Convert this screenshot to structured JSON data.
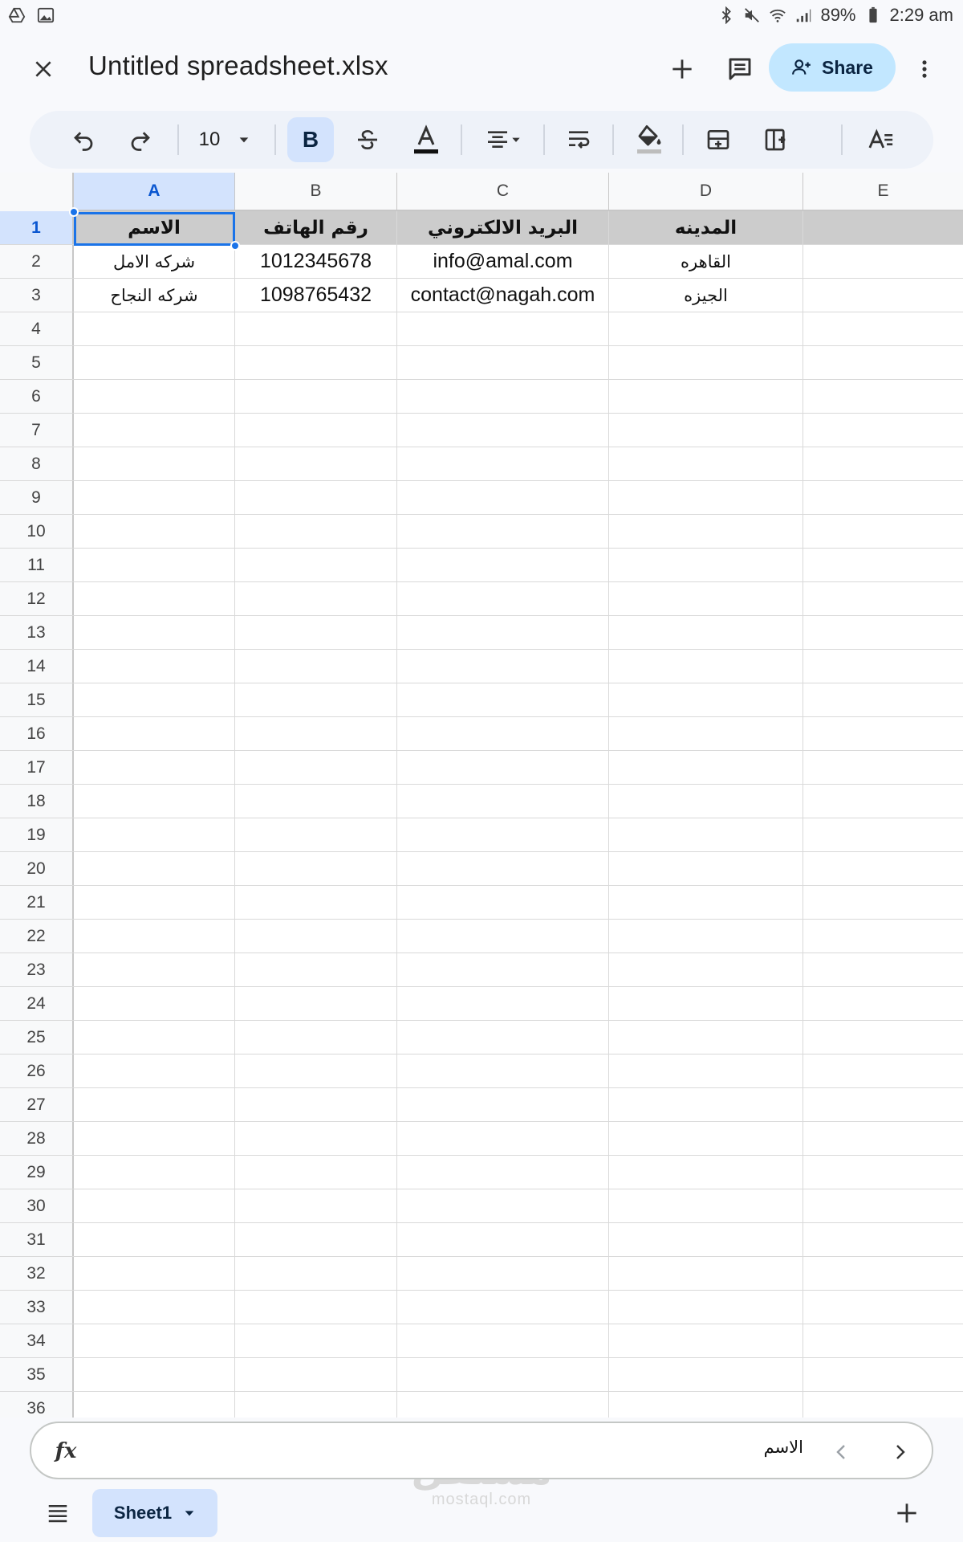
{
  "status_bar": {
    "battery": "89%",
    "time": "2:29 am"
  },
  "title_bar": {
    "doc_title": "Untitled spreadsheet.xlsx",
    "share_label": "Share"
  },
  "toolbar": {
    "font_size": "10",
    "bold_label": "B"
  },
  "grid": {
    "columns": [
      "A",
      "B",
      "C",
      "D",
      "E"
    ],
    "selected_column": "A",
    "selected_row": "1",
    "rows": [
      {
        "num": "1",
        "cells": [
          "الاسم",
          "رقم الهاتف",
          "البريد الالكتروني",
          "المدينه",
          ""
        ]
      },
      {
        "num": "2",
        "cells": [
          "شركه الامل",
          "1012345678",
          "info@amal.com",
          "القاهره",
          ""
        ]
      },
      {
        "num": "3",
        "cells": [
          "شركه النجاح",
          "1098765432",
          "contact@nagah.com",
          "الجيزه",
          ""
        ]
      },
      {
        "num": "4",
        "cells": [
          "",
          "",
          "",
          "",
          ""
        ]
      },
      {
        "num": "5",
        "cells": [
          "",
          "",
          "",
          "",
          ""
        ]
      },
      {
        "num": "6",
        "cells": [
          "",
          "",
          "",
          "",
          ""
        ]
      },
      {
        "num": "7",
        "cells": [
          "",
          "",
          "",
          "",
          ""
        ]
      },
      {
        "num": "8",
        "cells": [
          "",
          "",
          "",
          "",
          ""
        ]
      },
      {
        "num": "9",
        "cells": [
          "",
          "",
          "",
          "",
          ""
        ]
      },
      {
        "num": "10",
        "cells": [
          "",
          "",
          "",
          "",
          ""
        ]
      },
      {
        "num": "11",
        "cells": [
          "",
          "",
          "",
          "",
          ""
        ]
      },
      {
        "num": "12",
        "cells": [
          "",
          "",
          "",
          "",
          ""
        ]
      },
      {
        "num": "13",
        "cells": [
          "",
          "",
          "",
          "",
          ""
        ]
      },
      {
        "num": "14",
        "cells": [
          "",
          "",
          "",
          "",
          ""
        ]
      },
      {
        "num": "15",
        "cells": [
          "",
          "",
          "",
          "",
          ""
        ]
      },
      {
        "num": "16",
        "cells": [
          "",
          "",
          "",
          "",
          ""
        ]
      },
      {
        "num": "17",
        "cells": [
          "",
          "",
          "",
          "",
          ""
        ]
      },
      {
        "num": "18",
        "cells": [
          "",
          "",
          "",
          "",
          ""
        ]
      },
      {
        "num": "19",
        "cells": [
          "",
          "",
          "",
          "",
          ""
        ]
      },
      {
        "num": "20",
        "cells": [
          "",
          "",
          "",
          "",
          ""
        ]
      },
      {
        "num": "21",
        "cells": [
          "",
          "",
          "",
          "",
          ""
        ]
      },
      {
        "num": "22",
        "cells": [
          "",
          "",
          "",
          "",
          ""
        ]
      },
      {
        "num": "23",
        "cells": [
          "",
          "",
          "",
          "",
          ""
        ]
      },
      {
        "num": "24",
        "cells": [
          "",
          "",
          "",
          "",
          ""
        ]
      },
      {
        "num": "25",
        "cells": [
          "",
          "",
          "",
          "",
          ""
        ]
      },
      {
        "num": "26",
        "cells": [
          "",
          "",
          "",
          "",
          ""
        ]
      },
      {
        "num": "27",
        "cells": [
          "",
          "",
          "",
          "",
          ""
        ]
      },
      {
        "num": "28",
        "cells": [
          "",
          "",
          "",
          "",
          ""
        ]
      },
      {
        "num": "29",
        "cells": [
          "",
          "",
          "",
          "",
          ""
        ]
      },
      {
        "num": "30",
        "cells": [
          "",
          "",
          "",
          "",
          ""
        ]
      },
      {
        "num": "31",
        "cells": [
          "",
          "",
          "",
          "",
          ""
        ]
      },
      {
        "num": "32",
        "cells": [
          "",
          "",
          "",
          "",
          ""
        ]
      },
      {
        "num": "33",
        "cells": [
          "",
          "",
          "",
          "",
          ""
        ]
      },
      {
        "num": "34",
        "cells": [
          "",
          "",
          "",
          "",
          ""
        ]
      },
      {
        "num": "35",
        "cells": [
          "",
          "",
          "",
          "",
          ""
        ]
      },
      {
        "num": "36",
        "cells": [
          "",
          "",
          "",
          "",
          ""
        ]
      }
    ]
  },
  "formula_bar": {
    "value": "الاسم"
  },
  "bottom_bar": {
    "sheet_name": "Sheet1"
  },
  "watermark": {
    "arabic": "مستقل",
    "latin": "mostaql.com"
  },
  "colors": {
    "accent": "#1a73e8",
    "selected_header_bg": "#d3e3fd",
    "share_bg": "#c2e7ff",
    "header_row_bg": "#cccccc"
  }
}
